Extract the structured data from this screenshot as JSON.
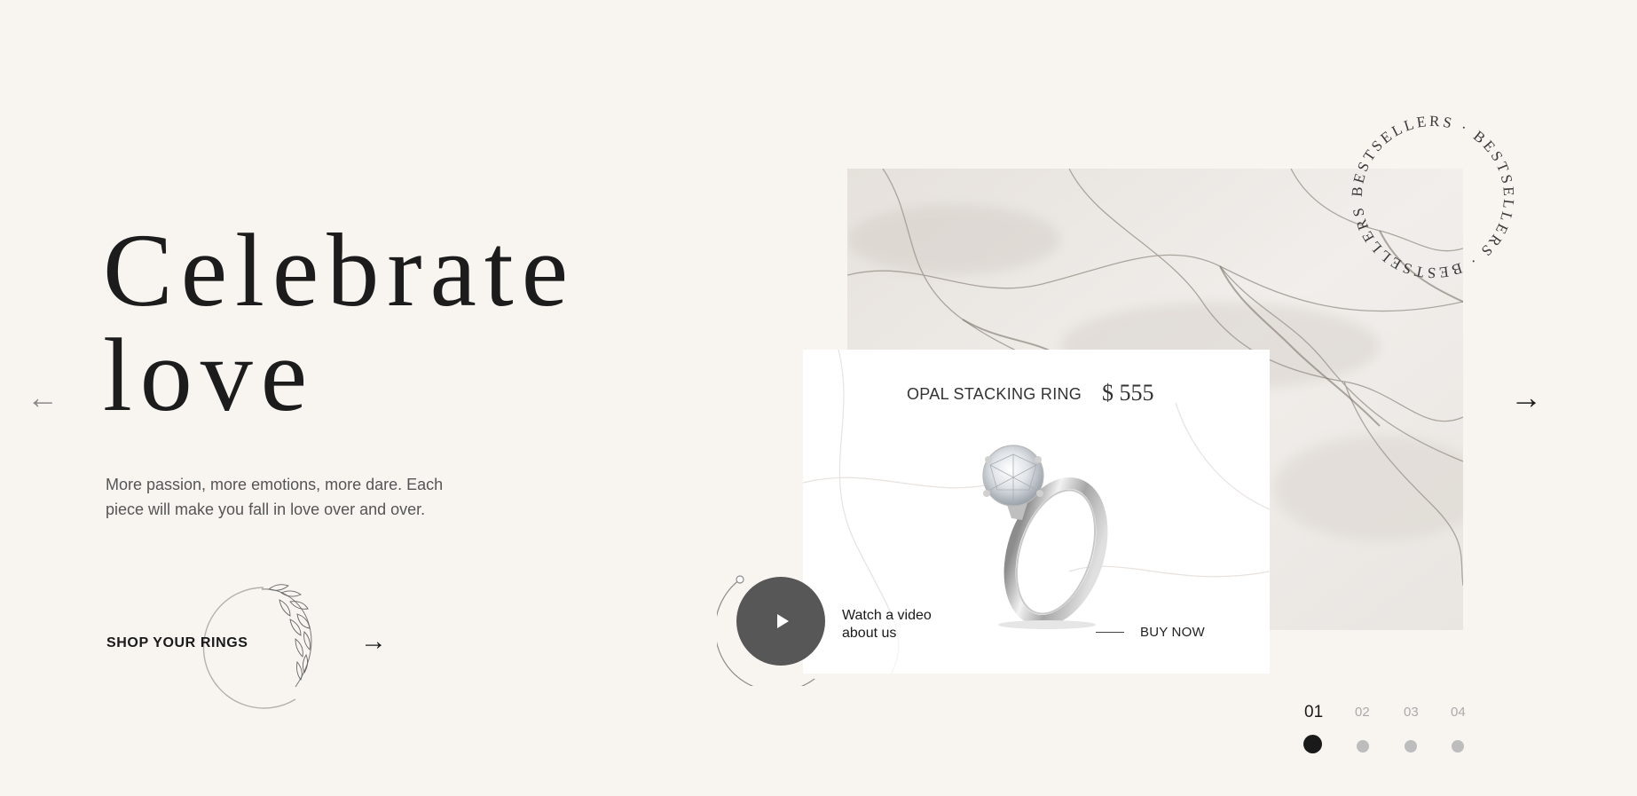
{
  "hero": {
    "title_line1": "Celebrate",
    "title_line2": "love",
    "subtitle": "More passion, more emotions, more dare. Each piece will make you fall in love over and over."
  },
  "nav": {
    "prev_icon": "←",
    "next_icon": "→"
  },
  "shop": {
    "label": "SHOP YOUR RINGS",
    "arrow_icon": "→"
  },
  "badge": {
    "text": "BESTSELLERS · BESTSELLERS · BESTSELLERS ·"
  },
  "product": {
    "name": "OPAL STACKING RING",
    "price": "$ 555",
    "buy_label": "BUY NOW"
  },
  "video": {
    "label": "Watch a video about us"
  },
  "pagination": {
    "pages": [
      {
        "label": "01",
        "active": true
      },
      {
        "label": "02",
        "active": false
      },
      {
        "label": "03",
        "active": false
      },
      {
        "label": "04",
        "active": false
      }
    ]
  },
  "colors": {
    "background": "#f8f5f1",
    "text": "#1a1a1a",
    "play_button": "#575757",
    "dot_inactive": "#bdbdbd"
  },
  "icons": [
    "arrow-left-icon",
    "arrow-right-icon",
    "play-icon",
    "leaf-wreath-icon",
    "ring-image"
  ]
}
